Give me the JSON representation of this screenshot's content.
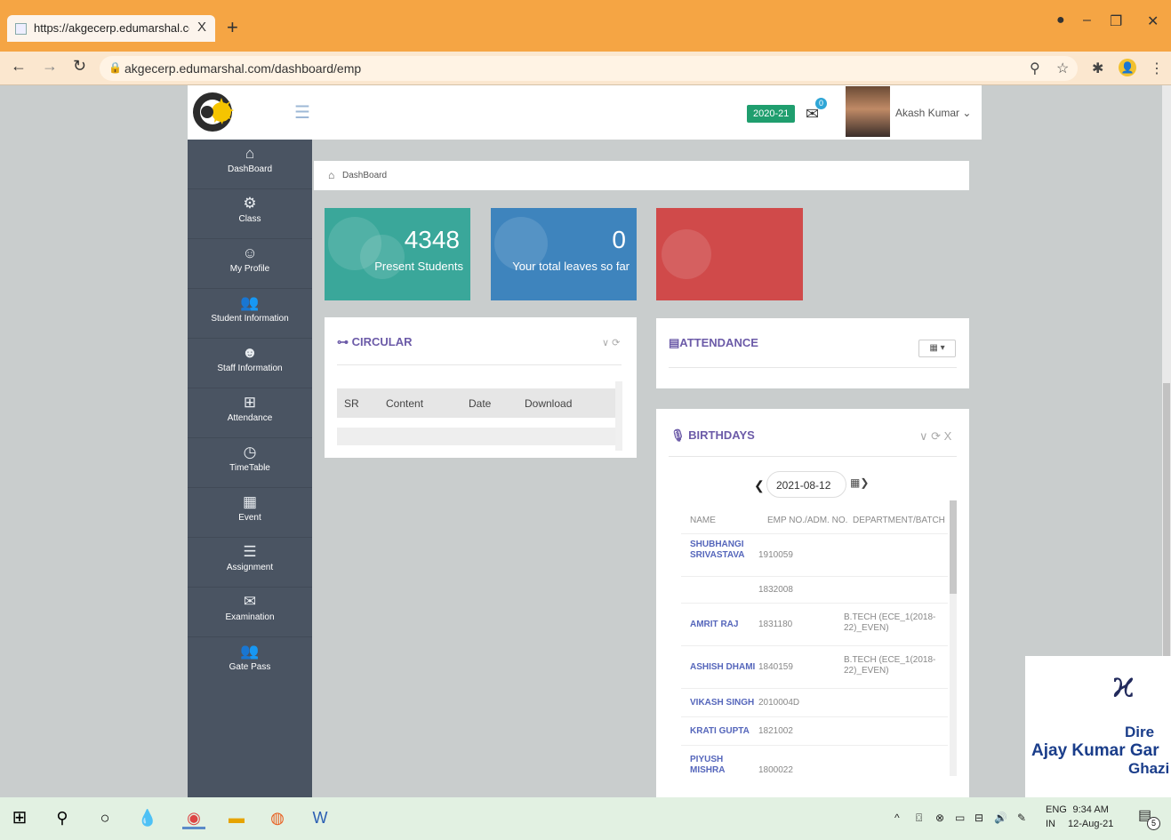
{
  "browser": {
    "tab_title": "https://akgecerp.edumarshal.com",
    "tab_close": "X",
    "new_tab": "+",
    "url": "akgecerp.edumarshal.com/dashboard/emp"
  },
  "topbar": {
    "session": "2020-21",
    "notifications_count": "0",
    "user_name": "Akash Kumar ⌄"
  },
  "sidebar": {
    "items": [
      {
        "label": "DashBoard",
        "icon": "home-icon"
      },
      {
        "label": "Class",
        "icon": "gear-icon"
      },
      {
        "label": "My Profile",
        "icon": "user-icon"
      },
      {
        "label": "Student Information",
        "icon": "users-icon"
      },
      {
        "label": "Staff Information",
        "icon": "staff-icon"
      },
      {
        "label": "Attendance",
        "icon": "calculator-icon"
      },
      {
        "label": "TimeTable",
        "icon": "clock-icon"
      },
      {
        "label": "Event",
        "icon": "calendar-icon"
      },
      {
        "label": "Assignment",
        "icon": "server-icon"
      },
      {
        "label": "Examination",
        "icon": "envelope-icon"
      },
      {
        "label": "Gate Pass",
        "icon": "users-icon"
      }
    ]
  },
  "breadcrumb": "DashBoard",
  "tiles": {
    "students_count": "4348",
    "students_label": "Present Students",
    "leaves_count": "0",
    "leaves_label": "Your total leaves so far",
    "colors": {
      "students": "#3aa79a",
      "leaves": "#3e84bd",
      "third": "#d04a4a"
    }
  },
  "circular": {
    "title": "CIRCULAR",
    "columns": {
      "sr": "SR",
      "content": "Content",
      "date": "Date",
      "download": "Download"
    }
  },
  "attendance": {
    "title": "ATTENDANCE"
  },
  "birthdays": {
    "title": "BIRTHDAYS",
    "date": "2021-08-12",
    "columns": {
      "name": "NAME",
      "emp": "EMP NO./ADM. NO.",
      "dept": "DEPARTMENT/BATCH"
    },
    "rows": [
      {
        "name": "SHUBHANGI SRIVASTAVA",
        "emp": "1910059",
        "dept": ""
      },
      {
        "name": "",
        "emp": "1832008",
        "dept": ""
      },
      {
        "name": "AMRIT RAJ",
        "emp": "1831180",
        "dept": "B.TECH (ECE_1(2018-22)_EVEN)"
      },
      {
        "name": "ASHISH DHAMI",
        "emp": "1840159",
        "dept": "B.TECH (ECE_1(2018-22)_EVEN)"
      },
      {
        "name": "VIKASH SINGH",
        "emp": "2010004D",
        "dept": ""
      },
      {
        "name": "KRATI GUPTA",
        "emp": "1821002",
        "dept": ""
      },
      {
        "name": "PIYUSH MISHRA",
        "emp": "1800022",
        "dept": ""
      }
    ]
  },
  "stamp": {
    "line1": "Dire",
    "line2": "Ajay Kumar Gar",
    "line3": "Ghazi"
  },
  "taskbar": {
    "lang_top": "ENG",
    "lang_bottom": "IN",
    "time": "9:34 AM",
    "date": "12-Aug-21",
    "notif_count": "5"
  }
}
